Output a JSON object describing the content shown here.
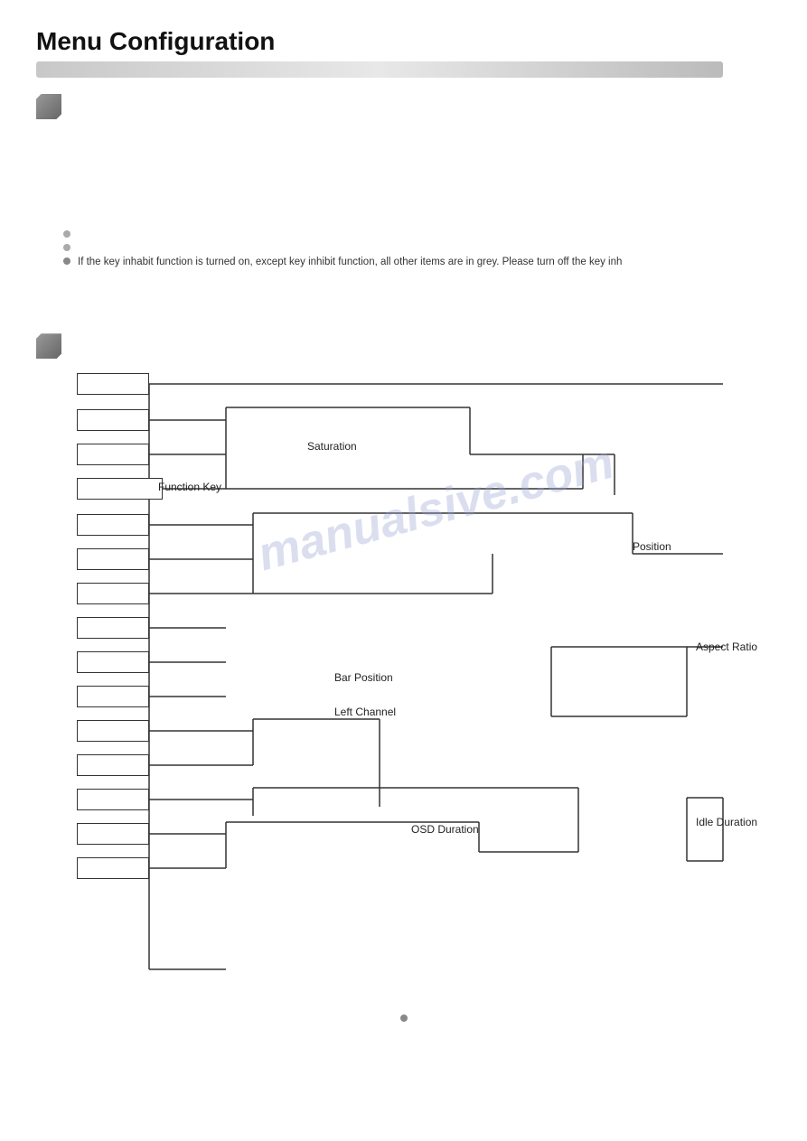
{
  "page": {
    "title": "Menu Configuration",
    "icon1": "cube-icon",
    "icon2": "cube-icon"
  },
  "bullets": {
    "items": [
      {
        "text": "",
        "type": "empty"
      },
      {
        "text": "",
        "type": "empty"
      },
      {
        "text": "If the key inhabit function is turned on, except key inhibit function, all other items are in grey. Please turn off the key inh",
        "type": "filled"
      }
    ]
  },
  "diagram": {
    "labels": {
      "saturation": "Saturation",
      "function_key": "Function Key",
      "position": "Position",
      "bar_position": "Bar Position",
      "left_channel": "Left Channel",
      "aspect_ratio": "Aspect Ratio",
      "idle_duration": "Idle Duration",
      "osd_duration": "OSD Duration"
    },
    "boxes": [
      {
        "id": "box1",
        "row": 0
      },
      {
        "id": "box2",
        "row": 1
      },
      {
        "id": "box3",
        "row": 2
      },
      {
        "id": "box4",
        "row": 3
      },
      {
        "id": "box5",
        "row": 4
      },
      {
        "id": "box6",
        "row": 5
      },
      {
        "id": "box7",
        "row": 6
      },
      {
        "id": "box8",
        "row": 7
      },
      {
        "id": "box9",
        "row": 8
      },
      {
        "id": "box10",
        "row": 9
      },
      {
        "id": "box11",
        "row": 10
      },
      {
        "id": "box12",
        "row": 11
      },
      {
        "id": "box13",
        "row": 12
      },
      {
        "id": "box14",
        "row": 13
      },
      {
        "id": "box15",
        "row": 14
      }
    ]
  },
  "watermark": {
    "text": "manualsive.com"
  },
  "bottom_note": {
    "dot": true
  }
}
